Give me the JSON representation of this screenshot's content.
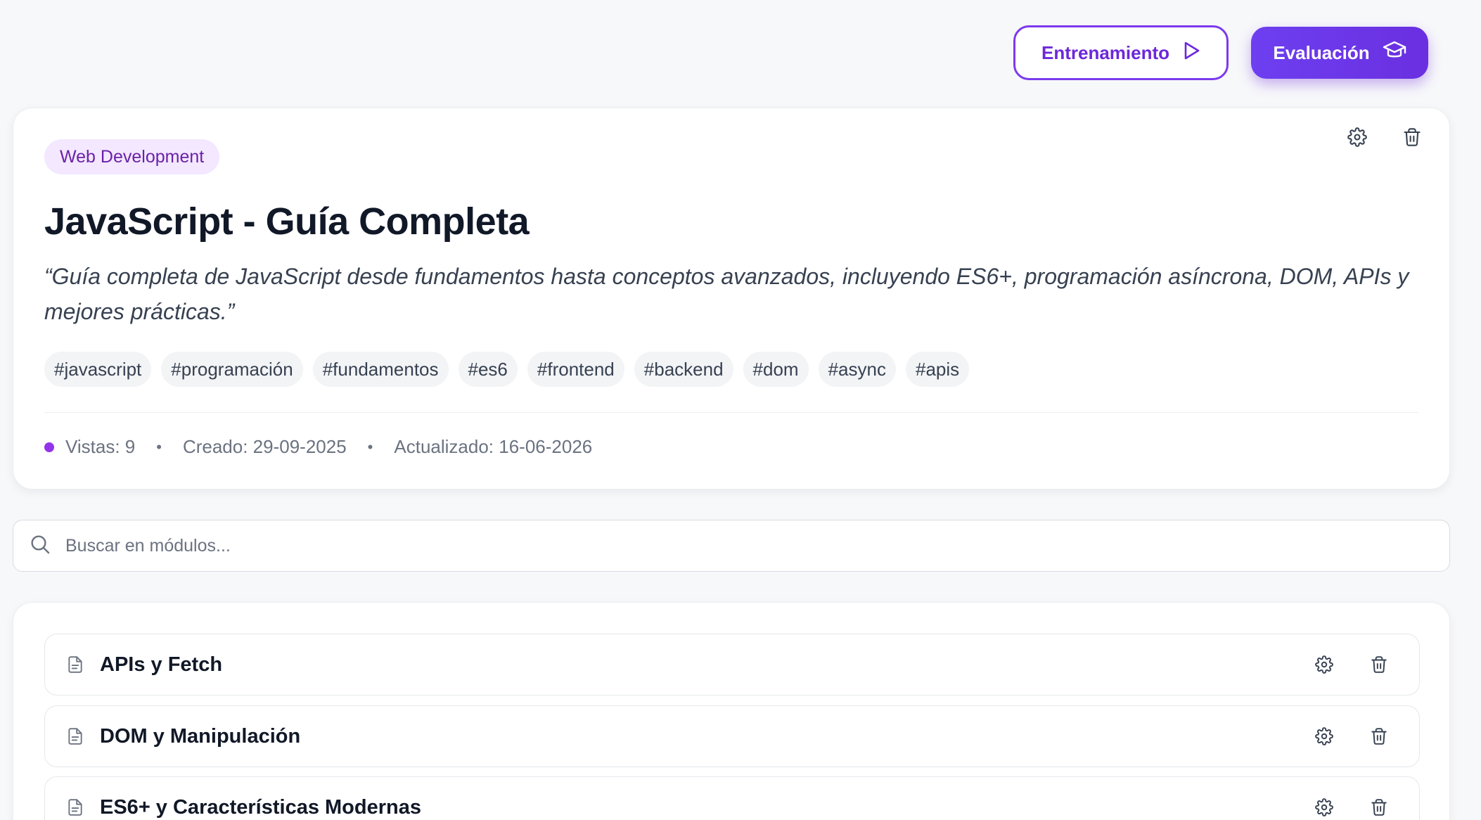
{
  "actions": {
    "training_label": "Entrenamiento",
    "evaluation_label": "Evaluación"
  },
  "course": {
    "category": "Web Development",
    "title": "JavaScript - Guía Completa",
    "description": "“Guía completa de JavaScript desde fundamentos hasta conceptos avanzados, incluyendo ES6+, programación asíncrona, DOM, APIs y mejores prácticas.”",
    "tags": [
      "#javascript",
      "#programación",
      "#fundamentos",
      "#es6",
      "#frontend",
      "#backend",
      "#dom",
      "#async",
      "#apis"
    ],
    "views": "Vistas: 9",
    "created": "Creado: 29-09-2025",
    "updated": "Actualizado: 16-06-2026",
    "separator": "•"
  },
  "search": {
    "placeholder": "Buscar en módulos..."
  },
  "modules": [
    {
      "title": "APIs y Fetch"
    },
    {
      "title": "DOM y Manipulación"
    },
    {
      "title": "ES6+ y Características Modernas"
    }
  ],
  "colors": {
    "accent": "#6d28d9",
    "badge_bg": "#f3e8ff",
    "views_dot": "#9333ea"
  },
  "icons": {
    "training": "play-icon",
    "evaluation": "graduation-cap-icon",
    "settings": "gear-icon",
    "delete": "trash-icon",
    "search": "search-icon",
    "module": "document-icon"
  }
}
